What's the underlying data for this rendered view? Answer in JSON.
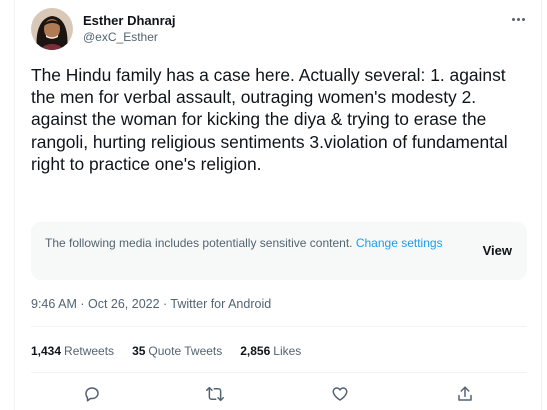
{
  "tweet": {
    "author_name": "Esther Dhanraj",
    "author_handle": "@exC_Esther",
    "text": "The Hindu family has a case here. Actually several: 1. against the men for verbal assault, outraging women's modesty 2. against the woman for kicking the diya & trying to erase the rangoli, hurting religious sentiments 3.violation of fundamental right to practice one's religion.",
    "timestamp": "9:46 AM · Oct 26, 2022 · Twitter for Android"
  },
  "warning": {
    "text": "The following media includes potentially sensitive content. ",
    "link": "Change settings",
    "view_label": "View"
  },
  "stats": {
    "retweets_count": "1,434",
    "retweets_label": "Retweets",
    "quotes_count": "35",
    "quotes_label": "Quote Tweets",
    "likes_count": "2,856",
    "likes_label": "Likes"
  },
  "actions": {
    "icons": [
      "reply-icon",
      "retweet-icon",
      "like-icon",
      "share-icon"
    ]
  },
  "colors": {
    "text": "#0f1419",
    "secondary": "#536471",
    "link": "#1d9bf0",
    "divider": "#eff3f4",
    "warning_bg": "#f7f9f9"
  }
}
